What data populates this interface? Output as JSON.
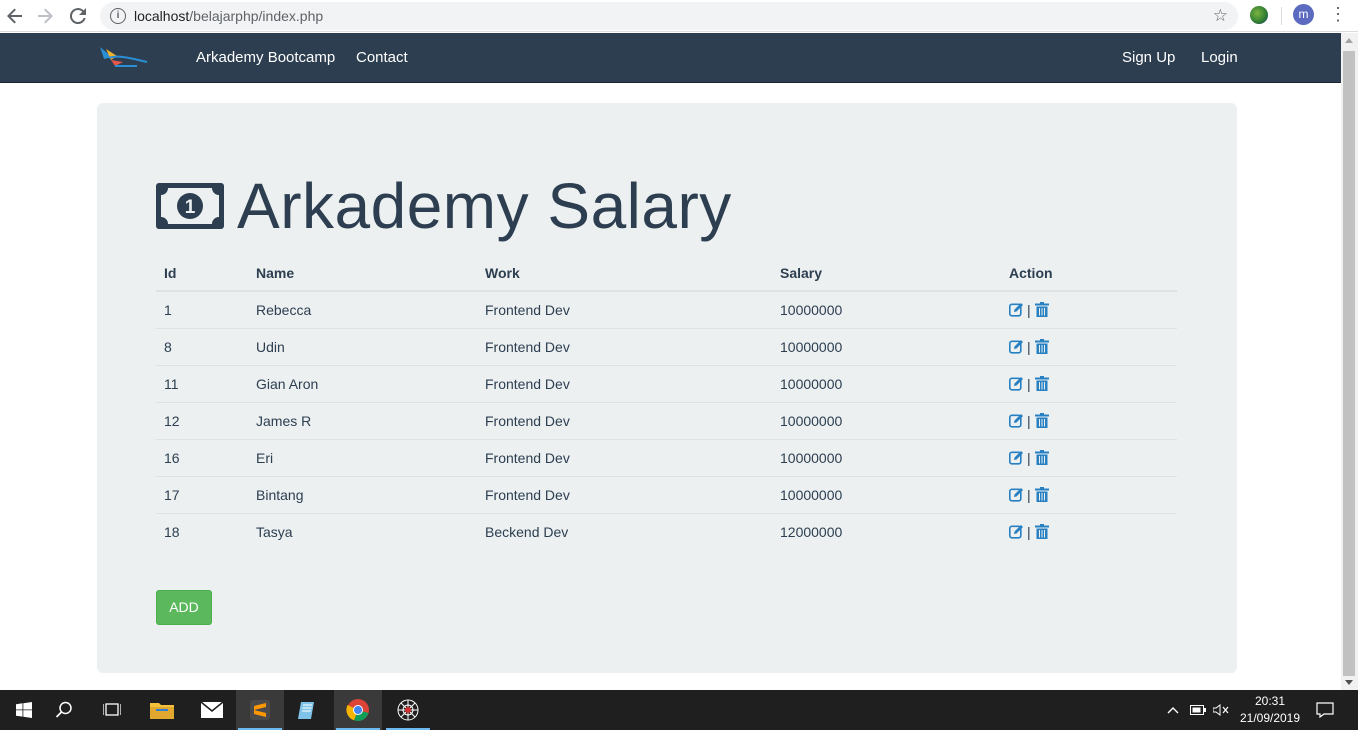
{
  "browser": {
    "url_host": "localhost",
    "url_path": "/belajarphp/index.php"
  },
  "profile": {
    "initial": "m"
  },
  "navbar": {
    "links_left": [
      "Arkademy Bootcamp",
      "Contact"
    ],
    "links_right": [
      "Sign Up",
      "Login"
    ]
  },
  "main": {
    "title": "Arkademy Salary",
    "table": {
      "headers": [
        "Id",
        "Name",
        "Work",
        "Salary",
        "Action"
      ],
      "rows": [
        {
          "id": "1",
          "name": "Rebecca",
          "work": "Frontend Dev",
          "salary": "10000000"
        },
        {
          "id": "8",
          "name": "Udin",
          "work": "Frontend Dev",
          "salary": "10000000"
        },
        {
          "id": "11",
          "name": "Gian Aron",
          "work": "Frontend Dev",
          "salary": "10000000"
        },
        {
          "id": "12",
          "name": "James R",
          "work": "Frontend Dev",
          "salary": "10000000"
        },
        {
          "id": "16",
          "name": "Eri",
          "work": "Frontend Dev",
          "salary": "10000000"
        },
        {
          "id": "17",
          "name": "Bintang",
          "work": "Frontend Dev",
          "salary": "10000000"
        },
        {
          "id": "18",
          "name": "Tasya",
          "work": "Beckend Dev",
          "salary": "12000000"
        }
      ],
      "action_separator": "|"
    },
    "add_label": "ADD"
  },
  "taskbar": {
    "time": "20:31",
    "date": "21/09/2019"
  },
  "colors": {
    "navbar": "#2c3e50",
    "jumbotron": "#ecf0f1",
    "action_icon": "#2780c2",
    "add_button": "#5cb85c"
  }
}
